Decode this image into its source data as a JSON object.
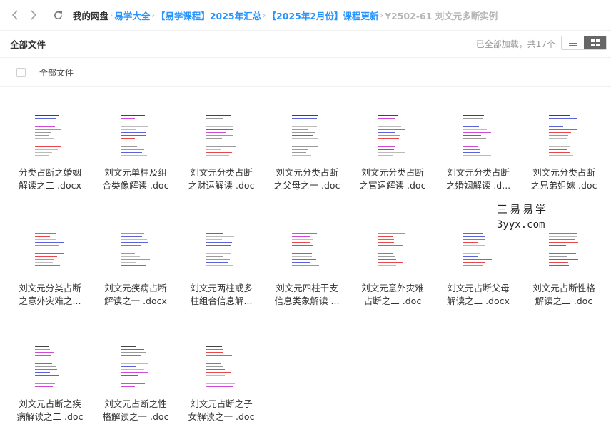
{
  "nav": {
    "back_icon": "chevron-left-icon",
    "forward_icon": "chevron-right-icon",
    "refresh_icon": "refresh-icon"
  },
  "breadcrumb": [
    "我的网盘",
    "易学大全",
    "【易学课程】2025年汇总",
    "【2025年2月份】课程更新",
    "Y2502-61 刘文元多断实例"
  ],
  "toolbar": {
    "title": "全部文件",
    "status": "已全部加载，共17个",
    "list_view_icon": "list-view-icon",
    "grid_view_icon": "grid-view-icon"
  },
  "selectbar": {
    "label": "全部文件"
  },
  "files": [
    {
      "line1": "分类占断之婚姻",
      "line2": "解读之二 .docx"
    },
    {
      "line1": "刘文元单柱及组",
      "line2": "合类像解读 .doc"
    },
    {
      "line1": "刘文元分类占断",
      "line2": "之财运解读 .doc"
    },
    {
      "line1": "刘文元分类占断",
      "line2": "之父母之一 .doc"
    },
    {
      "line1": "刘文元分类占断",
      "line2": "之官运解读 .doc"
    },
    {
      "line1": "刘文元分类占断",
      "line2": "之婚姻解读 .d..."
    },
    {
      "line1": "刘文元分类占断",
      "line2": "之兄弟姐妹 .doc"
    },
    {
      "line1": "刘文元分类占断",
      "line2": "之意外灾难之..."
    },
    {
      "line1": "刘文元疾病占断",
      "line2": "解读之一 .docx"
    },
    {
      "line1": "刘文元两柱或多",
      "line2": "柱组合信息解..."
    },
    {
      "line1": "刘文元四柱干支",
      "line2": "信息类象解读 ..."
    },
    {
      "line1": "刘文元意外灾难",
      "line2": "占断之二 .doc"
    },
    {
      "line1": "刘文元占断父母",
      "line2": "解读之二 .docx"
    },
    {
      "line1": "刘文元占断性格",
      "line2": "解读之二 .doc"
    },
    {
      "line1": "刘文元占断之疾",
      "line2": "病解读之二 .doc"
    },
    {
      "line1": "刘文元占断之性",
      "line2": "格解读之一 .doc"
    },
    {
      "line1": "刘文元占断之子",
      "line2": "女解读之一 .doc"
    }
  ],
  "watermark": {
    "line1": "三易易学",
    "line2": "3yyx.com"
  },
  "colors": {
    "link": "#2693ff",
    "current": "#b5b5b5",
    "doc_red": "#e8474c",
    "doc_magenta": "#d04ad8",
    "doc_blue": "#5a63d8"
  }
}
